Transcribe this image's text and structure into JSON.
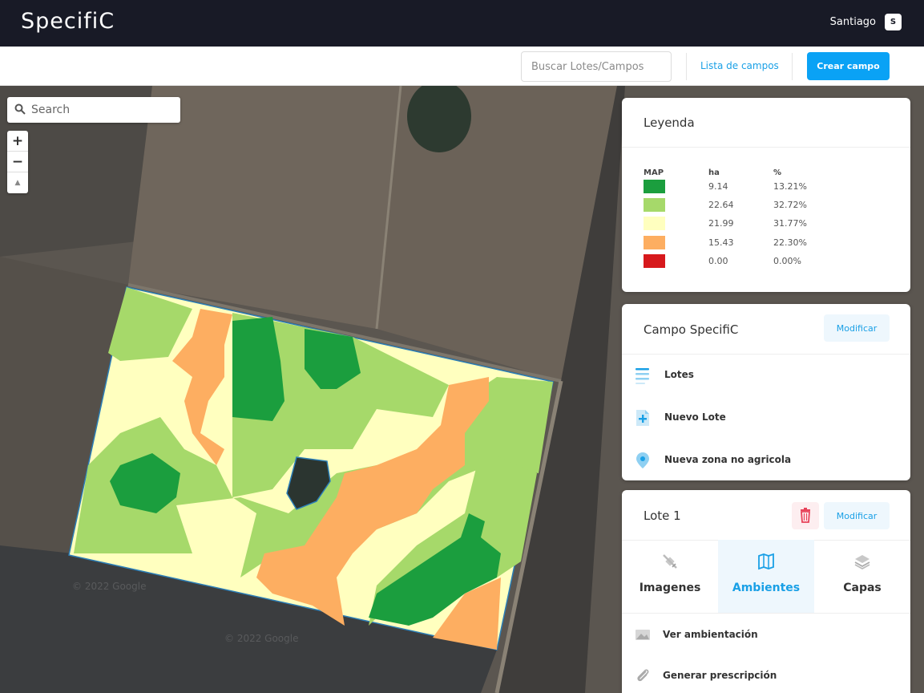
{
  "app": {
    "logo": "SpecifiC"
  },
  "user": {
    "name": "Santiago",
    "initial": "S"
  },
  "toolbar": {
    "search_placeholder": "Buscar Lotes/Campos",
    "lista_label": "Lista de campos",
    "crear_label": "Crear campo"
  },
  "map": {
    "search_placeholder": "Search",
    "zoom_in": "+",
    "zoom_out": "−",
    "compass": "▲",
    "watermark": "© 2022 Google"
  },
  "legend": {
    "title": "Leyenda",
    "col_map": "MAP",
    "col_ha": "ha",
    "col_pct": "%",
    "rows": [
      {
        "color": "#1b9e3e",
        "ha": "9.14",
        "pct": "13.21%"
      },
      {
        "color": "#a6d96a",
        "ha": "22.64",
        "pct": "32.72%"
      },
      {
        "color": "#ffffbf",
        "ha": "21.99",
        "pct": "31.77%"
      },
      {
        "color": "#fdae61",
        "ha": "15.43",
        "pct": "22.30%"
      },
      {
        "color": "#d7191c",
        "ha": "0.00",
        "pct": "0.00%"
      }
    ]
  },
  "campo": {
    "title": "Campo SpecifiC",
    "modify_label": "Modificar",
    "items": [
      {
        "label": "Lotes",
        "icon": "list-icon"
      },
      {
        "label": "Nuevo Lote",
        "icon": "add-document-icon"
      },
      {
        "label": "Nueva zona no agricola",
        "icon": "location-pin-icon"
      }
    ]
  },
  "lote": {
    "title": "Lote 1",
    "modify_label": "Modificar",
    "tabs": [
      {
        "label": "Imagenes",
        "icon": "satellite-icon",
        "active": false
      },
      {
        "label": "Ambientes",
        "icon": "map-icon",
        "active": true
      },
      {
        "label": "Capas",
        "icon": "layers-icon",
        "active": false
      }
    ],
    "actions": [
      {
        "label": "Ver ambientación",
        "icon": "image-icon"
      },
      {
        "label": "Generar prescripción",
        "icon": "paperclip-icon"
      }
    ]
  },
  "colors": {
    "accent": "#0aa2f5",
    "topbar": "#181a26",
    "danger": "#e8435a"
  }
}
